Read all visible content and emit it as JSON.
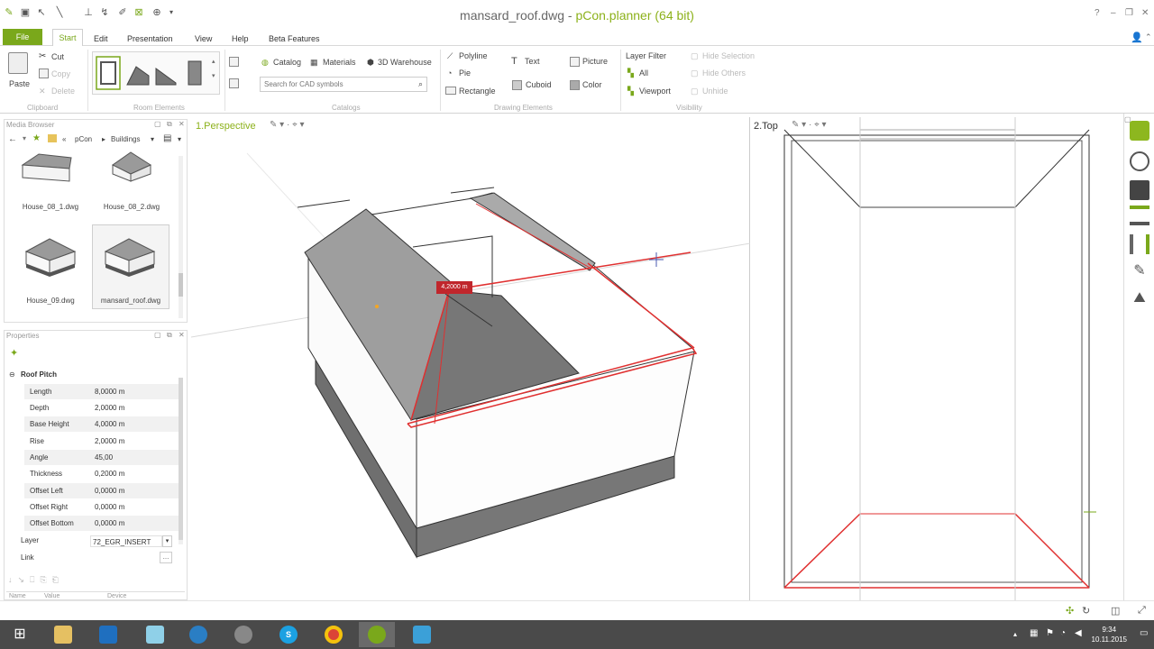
{
  "window": {
    "doc_name": "mansard_roof.dwg",
    "separator": " - ",
    "app_name": "pCon.planner (64 bit)",
    "help": "?",
    "minimize": "–",
    "restore": "❐",
    "close": "✕"
  },
  "menu": {
    "file": "File",
    "items": [
      "Start",
      "Edit",
      "Presentation",
      "View",
      "Help",
      "Beta Features"
    ]
  },
  "ribbon": {
    "clipboard": {
      "paste": "Paste",
      "cut": "Cut",
      "copy": "Copy",
      "delete": "Delete",
      "group": "Clipboard"
    },
    "room_elements": {
      "group": "Room Elements"
    },
    "catalogs": {
      "catalog": "Catalog",
      "materials": "Materials",
      "warehouse": "3D Warehouse",
      "search_placeholder": "Search for CAD symbols",
      "group": "Catalogs"
    },
    "drawing": {
      "polyline": "Polyline",
      "pie": "Pie",
      "rectangle": "Rectangle",
      "text": "Text",
      "cuboid": "Cuboid",
      "picture": "Picture",
      "color": "Color",
      "group": "Drawing Elements"
    },
    "visibility": {
      "layer_filter": "Layer Filter",
      "all": "All",
      "viewport": "Viewport",
      "hide_selection": "Hide Selection",
      "hide_others": "Hide Others",
      "unhide": "Unhide",
      "group": "Visibility"
    }
  },
  "media_browser": {
    "title": "Media Browser",
    "breadcrumb": [
      "«",
      "pCon",
      "Buildings"
    ],
    "items": [
      {
        "label": "House_08_1.dwg"
      },
      {
        "label": "House_08_2.dwg"
      },
      {
        "label": "House_09.dwg"
      },
      {
        "label": "mansard_roof.dwg"
      }
    ]
  },
  "properties": {
    "title": "Properties",
    "section": "Roof Pitch",
    "rows": [
      {
        "key": "Length",
        "value": "8,0000 m"
      },
      {
        "key": "Depth",
        "value": "2,0000 m"
      },
      {
        "key": "Base Height",
        "value": "4,0000 m"
      },
      {
        "key": "Rise",
        "value": "2,0000 m"
      },
      {
        "key": "Angle",
        "value": "45,00"
      },
      {
        "key": "Thickness",
        "value": "0,2000 m"
      },
      {
        "key": "Offset Left",
        "value": "0,0000 m"
      },
      {
        "key": "Offset Right",
        "value": "0,0000 m"
      },
      {
        "key": "Offset Bottom",
        "value": "0,0000 m"
      }
    ],
    "layer_key": "Layer",
    "layer_value": "72_EGR_INSERT",
    "link_key": "Link",
    "footer_cols": [
      "Name",
      "Value",
      "Device"
    ]
  },
  "viewports": {
    "perspective": "1.Perspective",
    "top": "2.Top",
    "dimension_tag": "4,2000 m"
  },
  "taskbar": {
    "time": "9:34",
    "date": "10.11.2015"
  },
  "colors": {
    "accent": "#7aa81b",
    "taskbar": "#4a4a4a",
    "roof_dark": "#7a7a7a",
    "highlight": "#e03030"
  }
}
